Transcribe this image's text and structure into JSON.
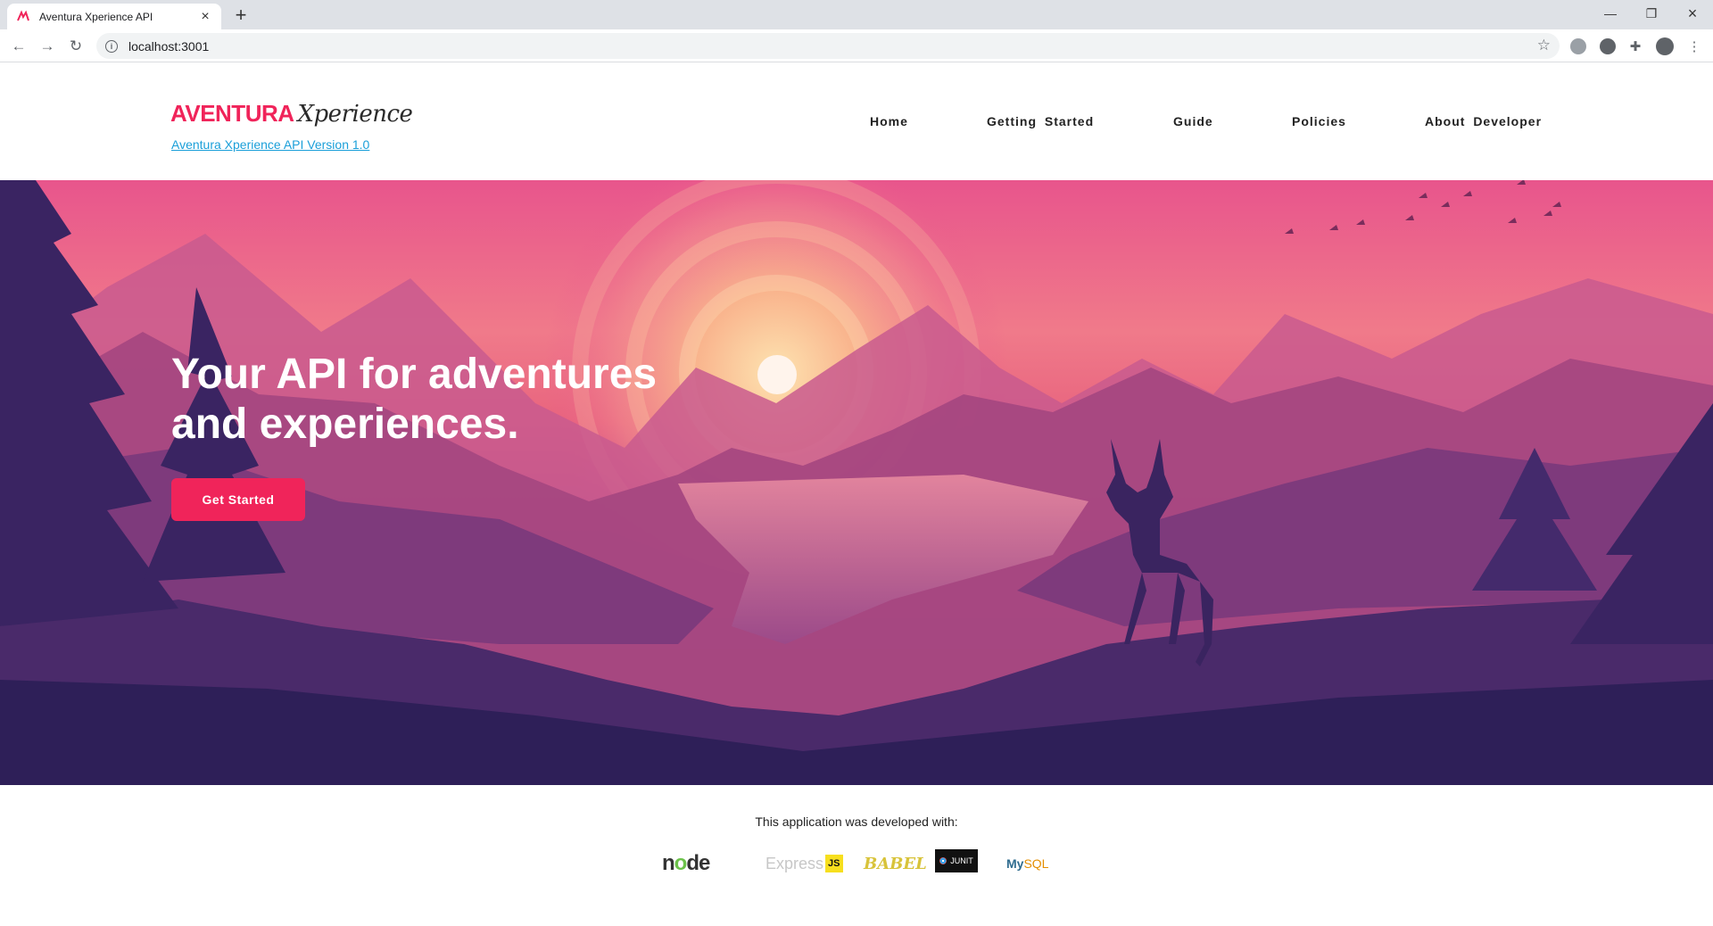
{
  "browser": {
    "tab_title": "Aventura Xperience API",
    "new_tab_icon": "plus-icon",
    "url": "localhost:3001",
    "window_controls": [
      "minimize",
      "restore",
      "close"
    ]
  },
  "header": {
    "logo_main": "AVENTURA",
    "logo_script": "Xperience",
    "version_link": "Aventura Xperience API Version 1.0",
    "nav": [
      {
        "label": "Home"
      },
      {
        "label": "Getting Started"
      },
      {
        "label": "Guide"
      },
      {
        "label": "Policies"
      },
      {
        "label": "About Developer"
      }
    ]
  },
  "hero": {
    "title_line1": "Your API for adventures",
    "title_line2": "and experiences.",
    "cta_label": "Get Started"
  },
  "footer": {
    "text": "This application was developed with:",
    "tech": {
      "node_a": "n",
      "node_b": "o",
      "node_c": "d",
      "node_d": "e",
      "express": "Express",
      "express_js": "JS",
      "babel": "BABEL",
      "junit": "JUNIT",
      "mysql_a": "My",
      "mysql_b": "SQL"
    }
  },
  "colors": {
    "brand": "#f0245a",
    "link": "#1a9fd9"
  }
}
